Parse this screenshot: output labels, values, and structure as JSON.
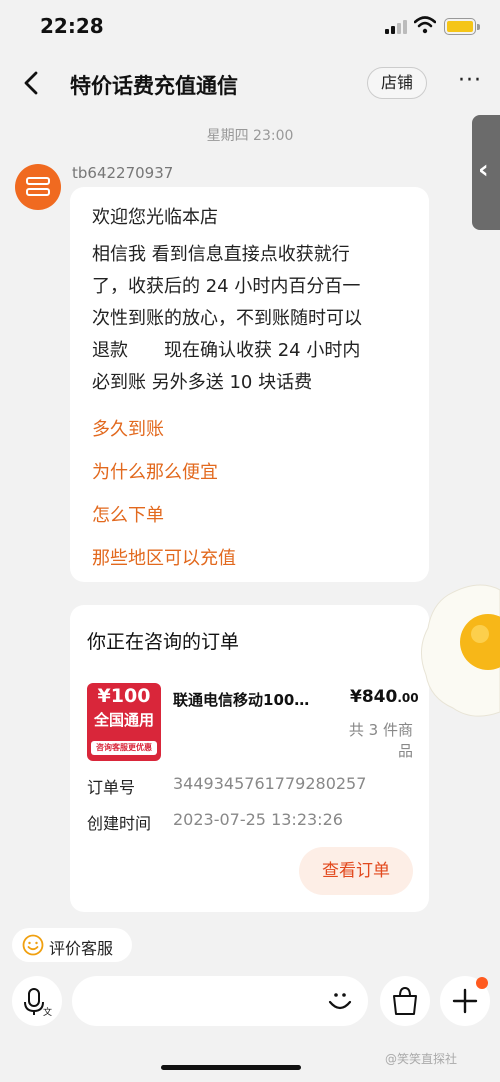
{
  "status_bar": {
    "time": "22:28"
  },
  "nav": {
    "title": "特价话费充值通信",
    "shop_button": "店铺",
    "more": "···"
  },
  "chat": {
    "timestamp": "星期四 23:00",
    "sender": "tb642270937",
    "message": {
      "title": "欢迎您光临本店",
      "lines": [
        "相信我 看到信息直接点收获就行",
        "了，收获后的 24 小时内百分百一",
        "次性到账的放心，不到账随时可以",
        "退款　　现在确认收获 24 小时内",
        "必到账 另外多送 10 块话费"
      ],
      "quick_links": [
        "多久到账",
        "为什么那么便宜",
        "怎么下单",
        "那些地区可以充值"
      ]
    }
  },
  "order_card": {
    "heading": "你正在咨询的订单",
    "product_image": {
      "price_tag": "¥100",
      "region": "全国通用",
      "note": "咨询客服更优惠"
    },
    "product_name": "联通电信移动100…",
    "price_main": "¥840",
    "price_cents": ".00",
    "item_count": "共 3 件商品",
    "order_no_label": "订单号",
    "order_no": "3449345761779280257",
    "created_label": "创建时间",
    "created_time": "2023-07-25 13:23:26",
    "view_button": "查看订单"
  },
  "rate_service": {
    "label": "评价客服",
    "icon": "smiley-icon"
  },
  "input_bar": {
    "placeholder": ""
  },
  "watermark": "@笑笑直探社",
  "colors": {
    "accent": "#e2691e",
    "background": "#f2f2f2",
    "avatar": "#f06a20",
    "badge": "#d9263a"
  }
}
